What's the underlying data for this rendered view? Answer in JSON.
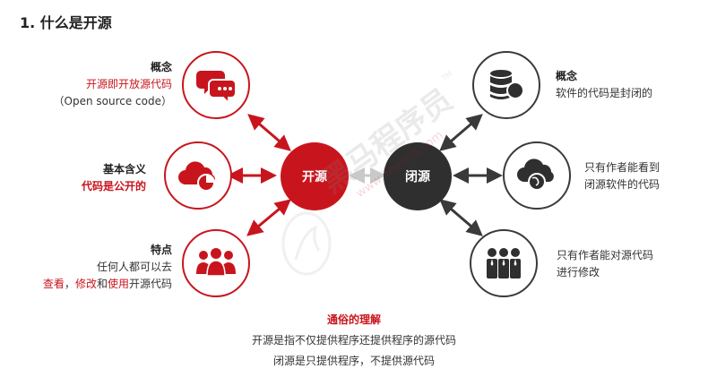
{
  "title": "1. 什么是开源",
  "open_source": {
    "hub_label": "开源",
    "concept": {
      "heading": "概念",
      "line1": "开源即开放源代码",
      "line2": "（Open source code）"
    },
    "meaning": {
      "heading": "基本含义",
      "line1": "代码是公开的"
    },
    "features": {
      "heading": "特点",
      "line1": "任何人都可以去",
      "line2_part1": "查看",
      "line2_sep1": "，",
      "line2_part2": "修改",
      "line2_sep2": "和",
      "line2_part3": "使用",
      "line2_tail": "开源代码"
    }
  },
  "closed_source": {
    "hub_label": "闭源",
    "concept": {
      "heading": "概念",
      "line1": "软件的代码是封闭的"
    },
    "visibility": {
      "line1": "只有作者能看到",
      "line2": "闭源软件的代码"
    },
    "modify": {
      "line1": "只有作者能对源代码",
      "line2": "进行修改"
    }
  },
  "summary": {
    "heading": "通俗的理解",
    "line1": "开源是指不仅提供程序还提供程序的源代码",
    "line2": "闭源是只提供程序，不提供源代码"
  },
  "watermark": {
    "brand": "黑马程序员",
    "tm": "TM",
    "url": "www.itheima.com"
  },
  "colors": {
    "accent_red": "#c8151d",
    "dark": "#2f2f2f"
  }
}
